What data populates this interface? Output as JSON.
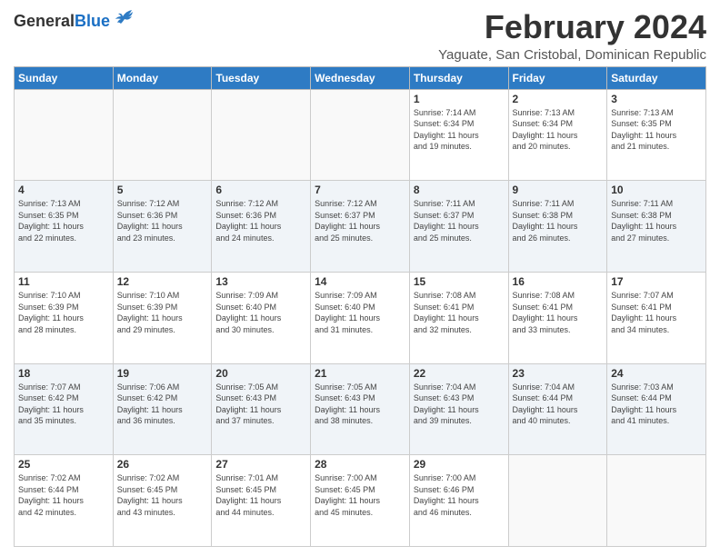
{
  "logo": {
    "line1": "General",
    "line2": "Blue"
  },
  "title": "February 2024",
  "subtitle": "Yaguate, San Cristobal, Dominican Republic",
  "weekdays": [
    "Sunday",
    "Monday",
    "Tuesday",
    "Wednesday",
    "Thursday",
    "Friday",
    "Saturday"
  ],
  "weeks": [
    [
      {
        "day": "",
        "info": ""
      },
      {
        "day": "",
        "info": ""
      },
      {
        "day": "",
        "info": ""
      },
      {
        "day": "",
        "info": ""
      },
      {
        "day": "1",
        "info": "Sunrise: 7:14 AM\nSunset: 6:34 PM\nDaylight: 11 hours\nand 19 minutes."
      },
      {
        "day": "2",
        "info": "Sunrise: 7:13 AM\nSunset: 6:34 PM\nDaylight: 11 hours\nand 20 minutes."
      },
      {
        "day": "3",
        "info": "Sunrise: 7:13 AM\nSunset: 6:35 PM\nDaylight: 11 hours\nand 21 minutes."
      }
    ],
    [
      {
        "day": "4",
        "info": "Sunrise: 7:13 AM\nSunset: 6:35 PM\nDaylight: 11 hours\nand 22 minutes."
      },
      {
        "day": "5",
        "info": "Sunrise: 7:12 AM\nSunset: 6:36 PM\nDaylight: 11 hours\nand 23 minutes."
      },
      {
        "day": "6",
        "info": "Sunrise: 7:12 AM\nSunset: 6:36 PM\nDaylight: 11 hours\nand 24 minutes."
      },
      {
        "day": "7",
        "info": "Sunrise: 7:12 AM\nSunset: 6:37 PM\nDaylight: 11 hours\nand 25 minutes."
      },
      {
        "day": "8",
        "info": "Sunrise: 7:11 AM\nSunset: 6:37 PM\nDaylight: 11 hours\nand 25 minutes."
      },
      {
        "day": "9",
        "info": "Sunrise: 7:11 AM\nSunset: 6:38 PM\nDaylight: 11 hours\nand 26 minutes."
      },
      {
        "day": "10",
        "info": "Sunrise: 7:11 AM\nSunset: 6:38 PM\nDaylight: 11 hours\nand 27 minutes."
      }
    ],
    [
      {
        "day": "11",
        "info": "Sunrise: 7:10 AM\nSunset: 6:39 PM\nDaylight: 11 hours\nand 28 minutes."
      },
      {
        "day": "12",
        "info": "Sunrise: 7:10 AM\nSunset: 6:39 PM\nDaylight: 11 hours\nand 29 minutes."
      },
      {
        "day": "13",
        "info": "Sunrise: 7:09 AM\nSunset: 6:40 PM\nDaylight: 11 hours\nand 30 minutes."
      },
      {
        "day": "14",
        "info": "Sunrise: 7:09 AM\nSunset: 6:40 PM\nDaylight: 11 hours\nand 31 minutes."
      },
      {
        "day": "15",
        "info": "Sunrise: 7:08 AM\nSunset: 6:41 PM\nDaylight: 11 hours\nand 32 minutes."
      },
      {
        "day": "16",
        "info": "Sunrise: 7:08 AM\nSunset: 6:41 PM\nDaylight: 11 hours\nand 33 minutes."
      },
      {
        "day": "17",
        "info": "Sunrise: 7:07 AM\nSunset: 6:41 PM\nDaylight: 11 hours\nand 34 minutes."
      }
    ],
    [
      {
        "day": "18",
        "info": "Sunrise: 7:07 AM\nSunset: 6:42 PM\nDaylight: 11 hours\nand 35 minutes."
      },
      {
        "day": "19",
        "info": "Sunrise: 7:06 AM\nSunset: 6:42 PM\nDaylight: 11 hours\nand 36 minutes."
      },
      {
        "day": "20",
        "info": "Sunrise: 7:05 AM\nSunset: 6:43 PM\nDaylight: 11 hours\nand 37 minutes."
      },
      {
        "day": "21",
        "info": "Sunrise: 7:05 AM\nSunset: 6:43 PM\nDaylight: 11 hours\nand 38 minutes."
      },
      {
        "day": "22",
        "info": "Sunrise: 7:04 AM\nSunset: 6:43 PM\nDaylight: 11 hours\nand 39 minutes."
      },
      {
        "day": "23",
        "info": "Sunrise: 7:04 AM\nSunset: 6:44 PM\nDaylight: 11 hours\nand 40 minutes."
      },
      {
        "day": "24",
        "info": "Sunrise: 7:03 AM\nSunset: 6:44 PM\nDaylight: 11 hours\nand 41 minutes."
      }
    ],
    [
      {
        "day": "25",
        "info": "Sunrise: 7:02 AM\nSunset: 6:44 PM\nDaylight: 11 hours\nand 42 minutes."
      },
      {
        "day": "26",
        "info": "Sunrise: 7:02 AM\nSunset: 6:45 PM\nDaylight: 11 hours\nand 43 minutes."
      },
      {
        "day": "27",
        "info": "Sunrise: 7:01 AM\nSunset: 6:45 PM\nDaylight: 11 hours\nand 44 minutes."
      },
      {
        "day": "28",
        "info": "Sunrise: 7:00 AM\nSunset: 6:45 PM\nDaylight: 11 hours\nand 45 minutes."
      },
      {
        "day": "29",
        "info": "Sunrise: 7:00 AM\nSunset: 6:46 PM\nDaylight: 11 hours\nand 46 minutes."
      },
      {
        "day": "",
        "info": ""
      },
      {
        "day": "",
        "info": ""
      }
    ]
  ]
}
